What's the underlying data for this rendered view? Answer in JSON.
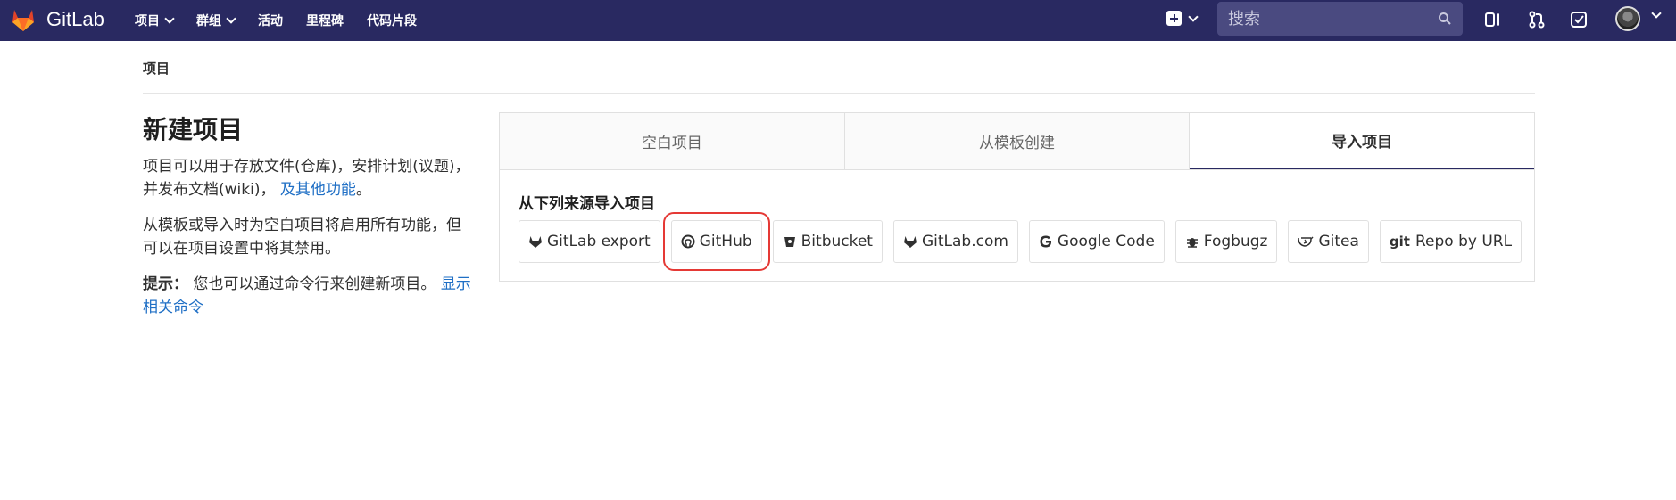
{
  "navbar": {
    "brand": "GitLab",
    "links": [
      {
        "label": "项目",
        "dropdown": true
      },
      {
        "label": "群组",
        "dropdown": true
      },
      {
        "label": "活动",
        "dropdown": false
      },
      {
        "label": "里程碑",
        "dropdown": false
      },
      {
        "label": "代码片段",
        "dropdown": false
      }
    ],
    "search_placeholder": "搜索",
    "icons": [
      "plus-icon",
      "search-icon",
      "issues-icon",
      "merge-request-icon",
      "todo-icon",
      "avatar"
    ]
  },
  "breadcrumb": "项目",
  "left": {
    "title": "新建项目",
    "desc": "项目可以用于存放文件(仓库)，安排计划(议题)，并发布文档(wiki)，",
    "desc_link": "及其他功能",
    "desc_end": "。",
    "desc2": "从模板或导入时为空白项目将启用所有功能，但可以在项目设置中将其禁用。",
    "tip_label": "提示：",
    "tip_text": "您也可以通过命令行来创建新项目。",
    "tip_link": "显示相关命令"
  },
  "tabs": [
    "空白项目",
    "从模板创建",
    "导入项目"
  ],
  "active_tab": "导入项目",
  "import": {
    "title": "从下列来源导入项目",
    "sources": [
      {
        "label": "GitLab export",
        "icon": "tanuki-icon"
      },
      {
        "label": "GitHub",
        "icon": "github-icon",
        "highlighted": true
      },
      {
        "label": "Bitbucket",
        "icon": "bitbucket-icon"
      },
      {
        "label": "GitLab.com",
        "icon": "tanuki-icon"
      },
      {
        "label": "Google Code",
        "icon": "google-icon"
      },
      {
        "label": "Fogbugz",
        "icon": "bug-icon"
      },
      {
        "label": "Gitea",
        "icon": "gitea-icon"
      },
      {
        "label": "Repo by URL",
        "icon": "git-icon"
      }
    ]
  },
  "colors": {
    "navbar": "#292961",
    "link": "#1f6fc5",
    "highlight": "#e53935"
  }
}
